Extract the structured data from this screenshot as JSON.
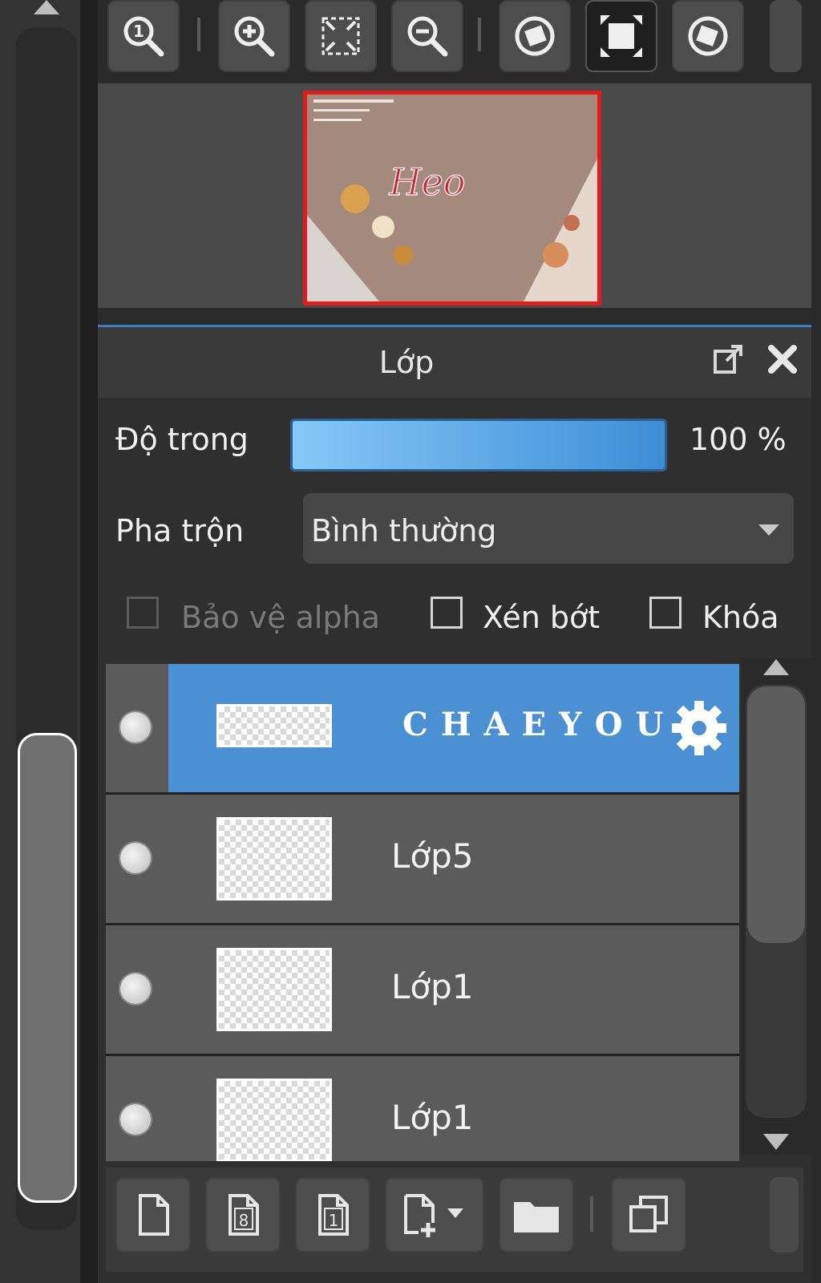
{
  "navigator": {
    "toolbar": {
      "buttons": [
        {
          "name": "actual-size",
          "icon": "zoom-100-icon"
        },
        {
          "name": "zoom-in",
          "icon": "zoom-in-icon"
        },
        {
          "name": "fit-window",
          "icon": "fit-window-icon"
        },
        {
          "name": "zoom-out",
          "icon": "zoom-out-icon"
        },
        {
          "name": "rotate-left",
          "icon": "rotate-left-icon"
        },
        {
          "name": "fullscreen",
          "icon": "fullscreen-icon",
          "active": true
        },
        {
          "name": "rotate-right",
          "icon": "rotate-right-icon"
        }
      ]
    },
    "preview_text": "Heo"
  },
  "layer_panel": {
    "title": "Lớp",
    "opacity": {
      "label": "Độ trong",
      "value_text": "100 %",
      "value": 100
    },
    "blend": {
      "label": "Pha trộn",
      "value": "Bình thường"
    },
    "checkboxes": {
      "alpha": {
        "label": "Bảo vệ alpha",
        "checked": false,
        "enabled": false
      },
      "clip": {
        "label": "Xén bớt",
        "checked": false,
        "enabled": true
      },
      "lock": {
        "label": "Khóa",
        "checked": false,
        "enabled": true
      }
    },
    "layers": [
      {
        "name": "CHAEYOU",
        "selected": true
      },
      {
        "name": "Lớp5",
        "selected": false
      },
      {
        "name": "Lớp1",
        "selected": false
      },
      {
        "name": "Lớp1",
        "selected": false
      }
    ],
    "bottom_toolbar": [
      {
        "name": "new-layer",
        "icon": "new-page-icon"
      },
      {
        "name": "new-8bit-layer",
        "icon": "8bit-layer-icon",
        "glyph": "8"
      },
      {
        "name": "new-1bit-layer",
        "icon": "1bit-layer-icon",
        "glyph": "1"
      },
      {
        "name": "add-layer-menu",
        "icon": "add-layer-dropdown-icon"
      },
      {
        "name": "new-folder",
        "icon": "folder-icon"
      },
      {
        "name": "duplicate-layer",
        "icon": "duplicate-icon"
      }
    ]
  },
  "colors": {
    "selection": "#4a90d3",
    "opacity_bar_start": "#86c9f7",
    "opacity_bar_end": "#3d8dd6",
    "preview_border": "#e31b1b"
  }
}
